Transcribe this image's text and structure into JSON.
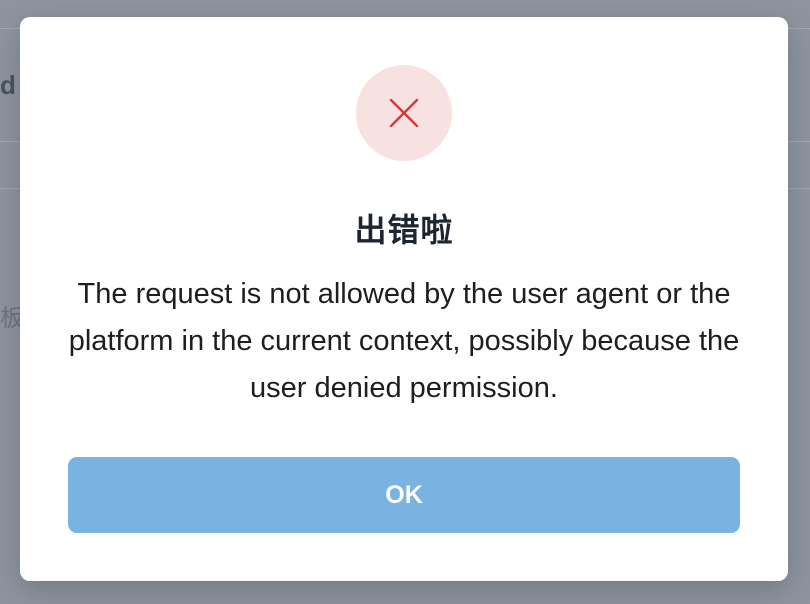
{
  "background": {
    "header_fragment": "d",
    "label_fragment": "板"
  },
  "dialog": {
    "icon": "close-icon",
    "icon_color": "#d23b3b",
    "title": "出错啦",
    "message": "The request is not allowed by the user agent or the platform in the current context, possibly because the user denied permission.",
    "ok_label": "OK",
    "ok_color": "#79b3e1"
  }
}
